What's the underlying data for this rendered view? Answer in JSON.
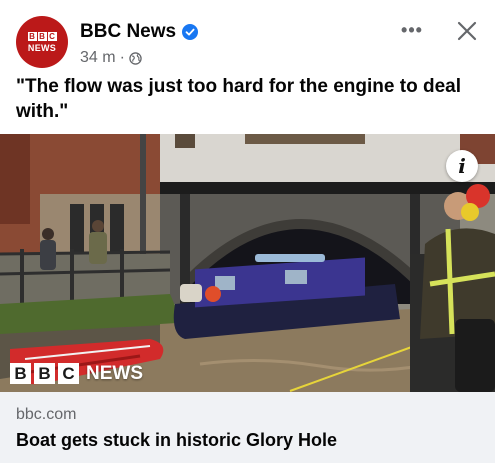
{
  "post": {
    "page_name": "BBC News",
    "verified": true,
    "timestamp": "34 m",
    "separator": "·",
    "audience_icon": "globe-icon",
    "avatar_logo": {
      "blocks": [
        "B",
        "B",
        "C"
      ],
      "word": "NEWS"
    },
    "caption": "\"The flow was just too hard for the engine to deal with.\"",
    "actions": {
      "more": "more-options-icon",
      "close": "close-icon"
    }
  },
  "photo": {
    "watermark_blocks": [
      "B",
      "B",
      "C"
    ],
    "watermark_word": "NEWS",
    "info_icon": "i"
  },
  "link_preview": {
    "domain": "bbc.com",
    "headline": "Boat gets stuck in historic Glory Hole"
  },
  "colors": {
    "bbc_red": "#bb1919",
    "verified_blue": "#1877f2",
    "secondary_text": "#65676b",
    "card_background": "#f0f2f5"
  }
}
